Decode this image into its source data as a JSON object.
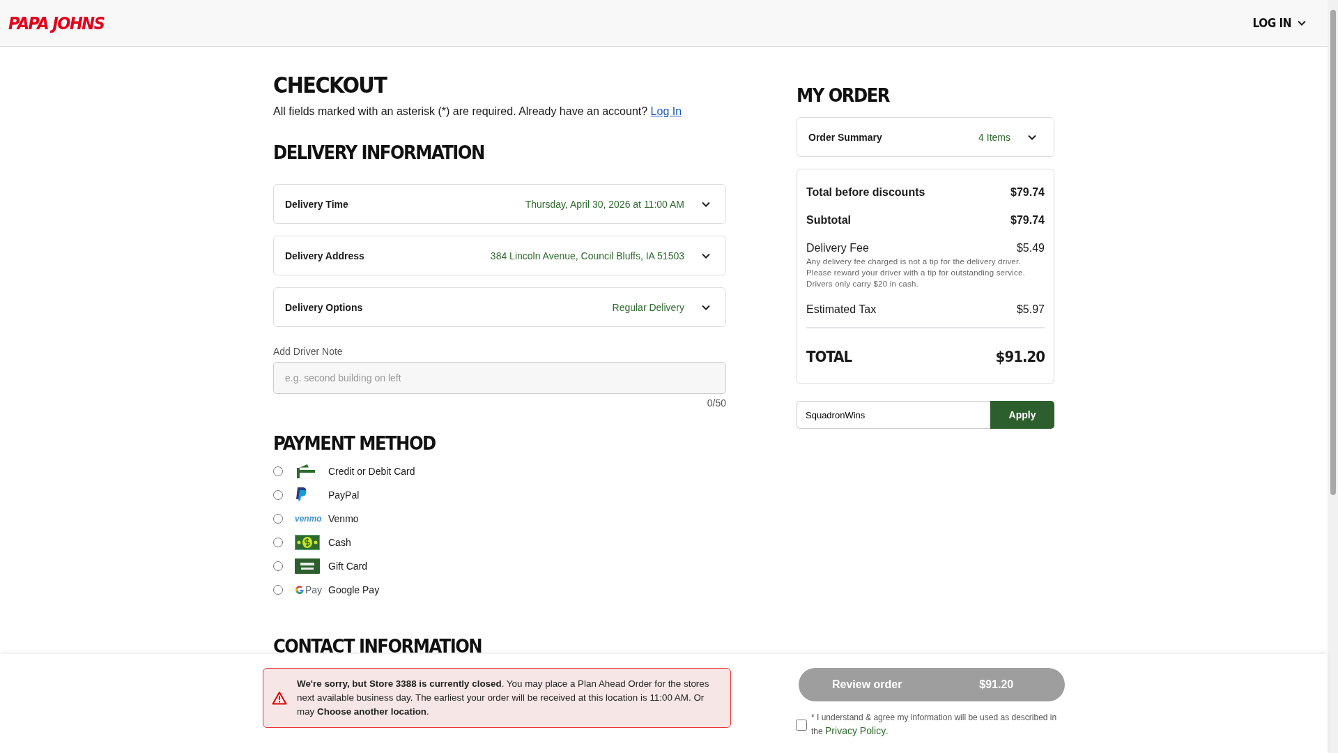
{
  "header": {
    "logo": "PAPA JOHNS",
    "login": "LOG IN"
  },
  "checkout": {
    "title": "CHECKOUT",
    "required_note": "All fields marked with an asterisk (*) are required. Already have an account?",
    "login_link": "Log In"
  },
  "delivery": {
    "title": "DELIVERY INFORMATION",
    "rows": [
      {
        "label": "Delivery Time",
        "value": "Thursday, April 30, 2026 at 11:00 AM",
        "expanded": false
      },
      {
        "label": "Delivery Address",
        "value": "384 Lincoln Avenue, Council Bluffs, IA 51503",
        "expanded": false
      },
      {
        "label": "Delivery Options",
        "value": "Regular Delivery",
        "expanded": false
      }
    ],
    "driver_note": {
      "label": "Add Driver Note",
      "placeholder": "e.g. second building on left",
      "counter": "0/50"
    }
  },
  "payment": {
    "title": "PAYMENT METHOD",
    "methods": [
      {
        "kind": "card",
        "label": "Credit or Debit Card",
        "selected": false
      },
      {
        "kind": "paypal",
        "label": "PayPal",
        "selected": false
      },
      {
        "kind": "venmo",
        "icon_text": "venmo",
        "label": "Venmo",
        "selected": false
      },
      {
        "kind": "cash",
        "label": "Cash",
        "selected": false
      },
      {
        "kind": "gift",
        "label": "Gift Card",
        "selected": false
      },
      {
        "kind": "gpay",
        "icon_text": "Pay",
        "label": "Google Pay",
        "selected": false
      }
    ]
  },
  "contact": {
    "title": "CONTACT INFORMATION"
  },
  "order": {
    "title": "MY ORDER",
    "summary": {
      "label": "Order Summary",
      "count": "4 Items",
      "expanded": false
    },
    "lines": [
      {
        "kind": "bold",
        "label": "Total before discounts",
        "amount": "$79.74"
      },
      {
        "kind": "bold",
        "label": "Subtotal",
        "amount": "$79.74"
      },
      {
        "kind": "regular",
        "label": "Delivery Fee",
        "amount": "$5.49",
        "note": "Any delivery fee charged is not a tip for the delivery driver. Please reward your driver with a tip for outstanding service. Drivers only carry $20 in cash."
      },
      {
        "kind": "regular",
        "label": "Estimated Tax",
        "amount": "$5.97"
      },
      {
        "kind": "total",
        "label": "TOTAL",
        "amount": "$91.20"
      }
    ],
    "promo": {
      "value": "SquadronWins",
      "button": "Apply"
    }
  },
  "footer": {
    "alert": "**We're sorry, but Store 3388 is currently closed**. You may place a Plan Ahead Order for the stores next available business day. The earliest your order will be received at this location is 11:00 AM. Or may **Choose another location**.",
    "review": {
      "label": "Review order",
      "amount": "$91.20",
      "disabled": true
    },
    "consent": {
      "checked": false,
      "text": "* I understand & agree my information will be used as described in the",
      "link": "Privacy Policy",
      "after": "."
    }
  }
}
